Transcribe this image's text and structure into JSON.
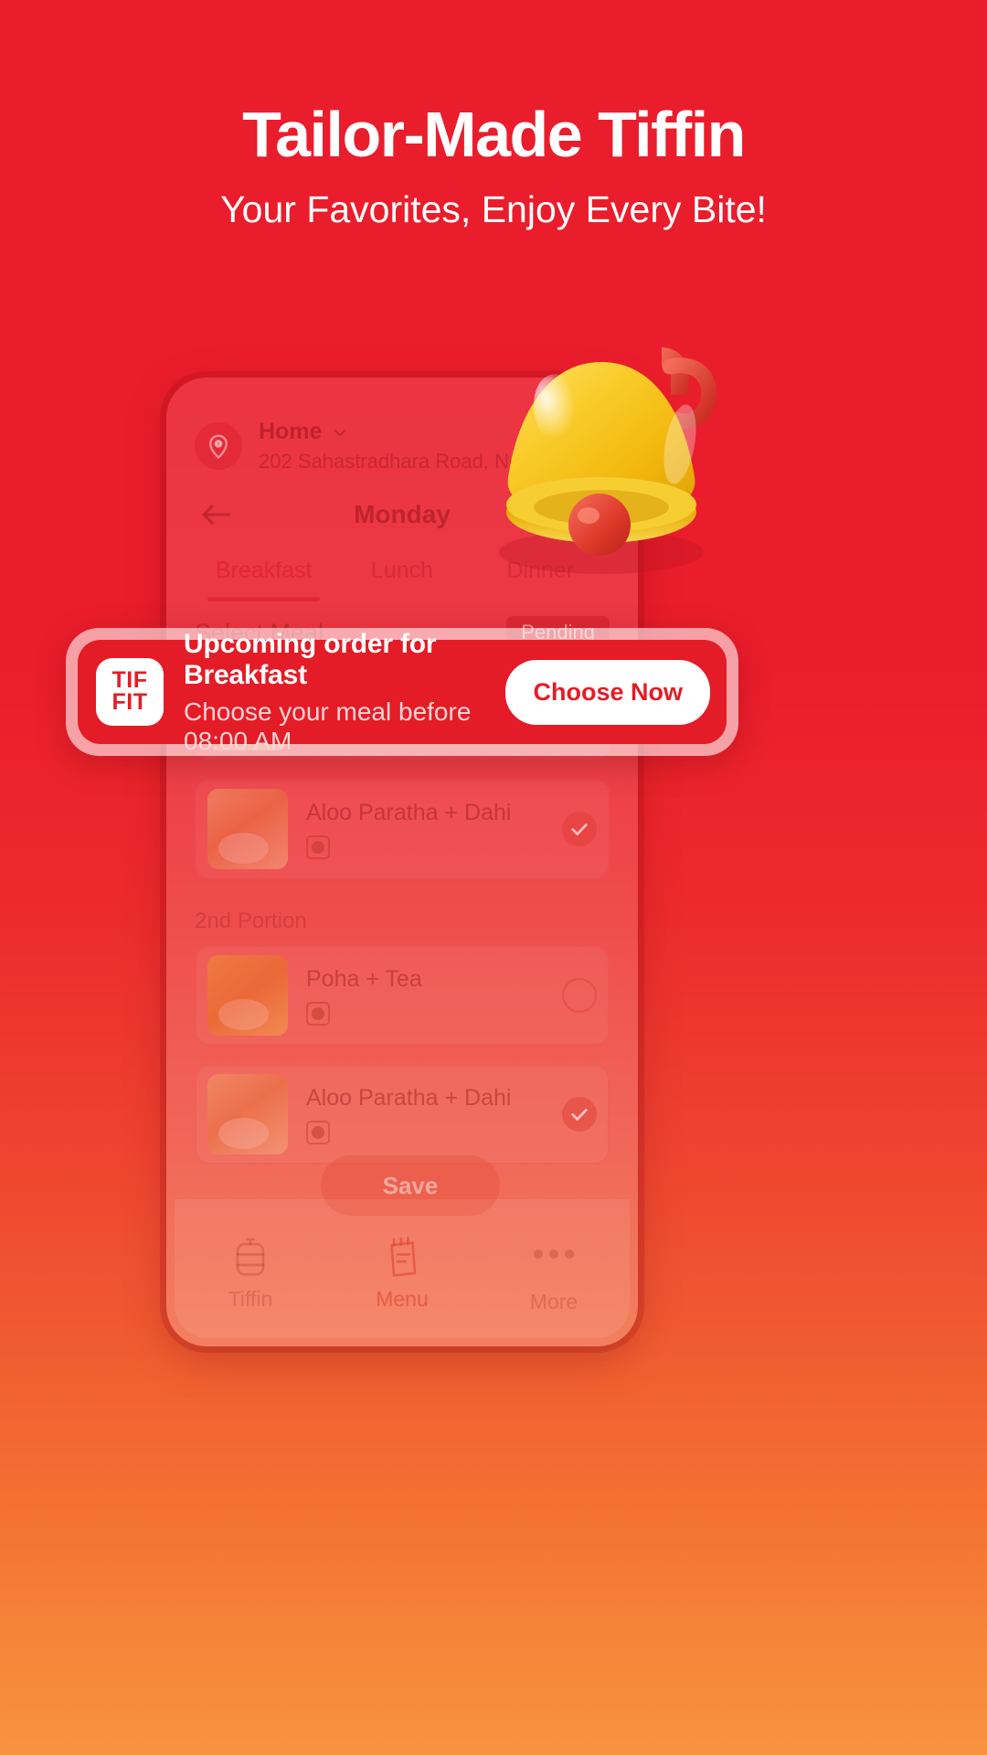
{
  "hero": {
    "headline": "Tailor-Made Tiffin",
    "subheadline": "Your Favorites, Enjoy Every Bite!"
  },
  "colors": {
    "brand_red": "#e41c27",
    "background_top": "#ea1d2c",
    "background_bottom": "#f79340",
    "bell_yellow": "#f5c518",
    "white": "#ffffff"
  },
  "phone_app": {
    "address": {
      "pin_icon": "location-pin-icon",
      "label": "Home",
      "chevron_icon": "chevron-down-icon",
      "line": "202 Sahastradhara Road, Near ..."
    },
    "day_header": {
      "back_icon": "back-arrow-icon",
      "day": "Monday"
    },
    "tabs": [
      {
        "label": "Breakfast",
        "active": true
      },
      {
        "label": "Lunch",
        "active": false
      },
      {
        "label": "Dinner",
        "active": false
      }
    ],
    "select_meal": {
      "label": "Select Meal",
      "status_badge": "Pending"
    },
    "portion_label": "2nd Portion",
    "meals_first_portion": [
      {
        "name": "Aloo Paratha + Dahi",
        "veg": true,
        "selected": true
      }
    ],
    "meals_second_portion": [
      {
        "name": "Poha + Tea",
        "veg": true,
        "selected": false
      },
      {
        "name": "Aloo Paratha + Dahi",
        "veg": true,
        "selected": true
      }
    ],
    "save_button": "Save",
    "bottom_nav": [
      {
        "label": "Tiffin",
        "icon": "tiffin-box-icon",
        "active": false
      },
      {
        "label": "Menu",
        "icon": "menu-notepad-icon",
        "active": true
      },
      {
        "label": "More",
        "icon": "more-dots-icon",
        "active": false
      }
    ]
  },
  "notification_banner": {
    "logo_line1": "TIF",
    "logo_line2": "FIT",
    "title": "Upcoming order for Breakfast",
    "subtitle": "Choose your meal before 08:00 AM",
    "cta_label": "Choose Now"
  },
  "decor": {
    "bell_icon": "notification-bell-3d-icon"
  }
}
